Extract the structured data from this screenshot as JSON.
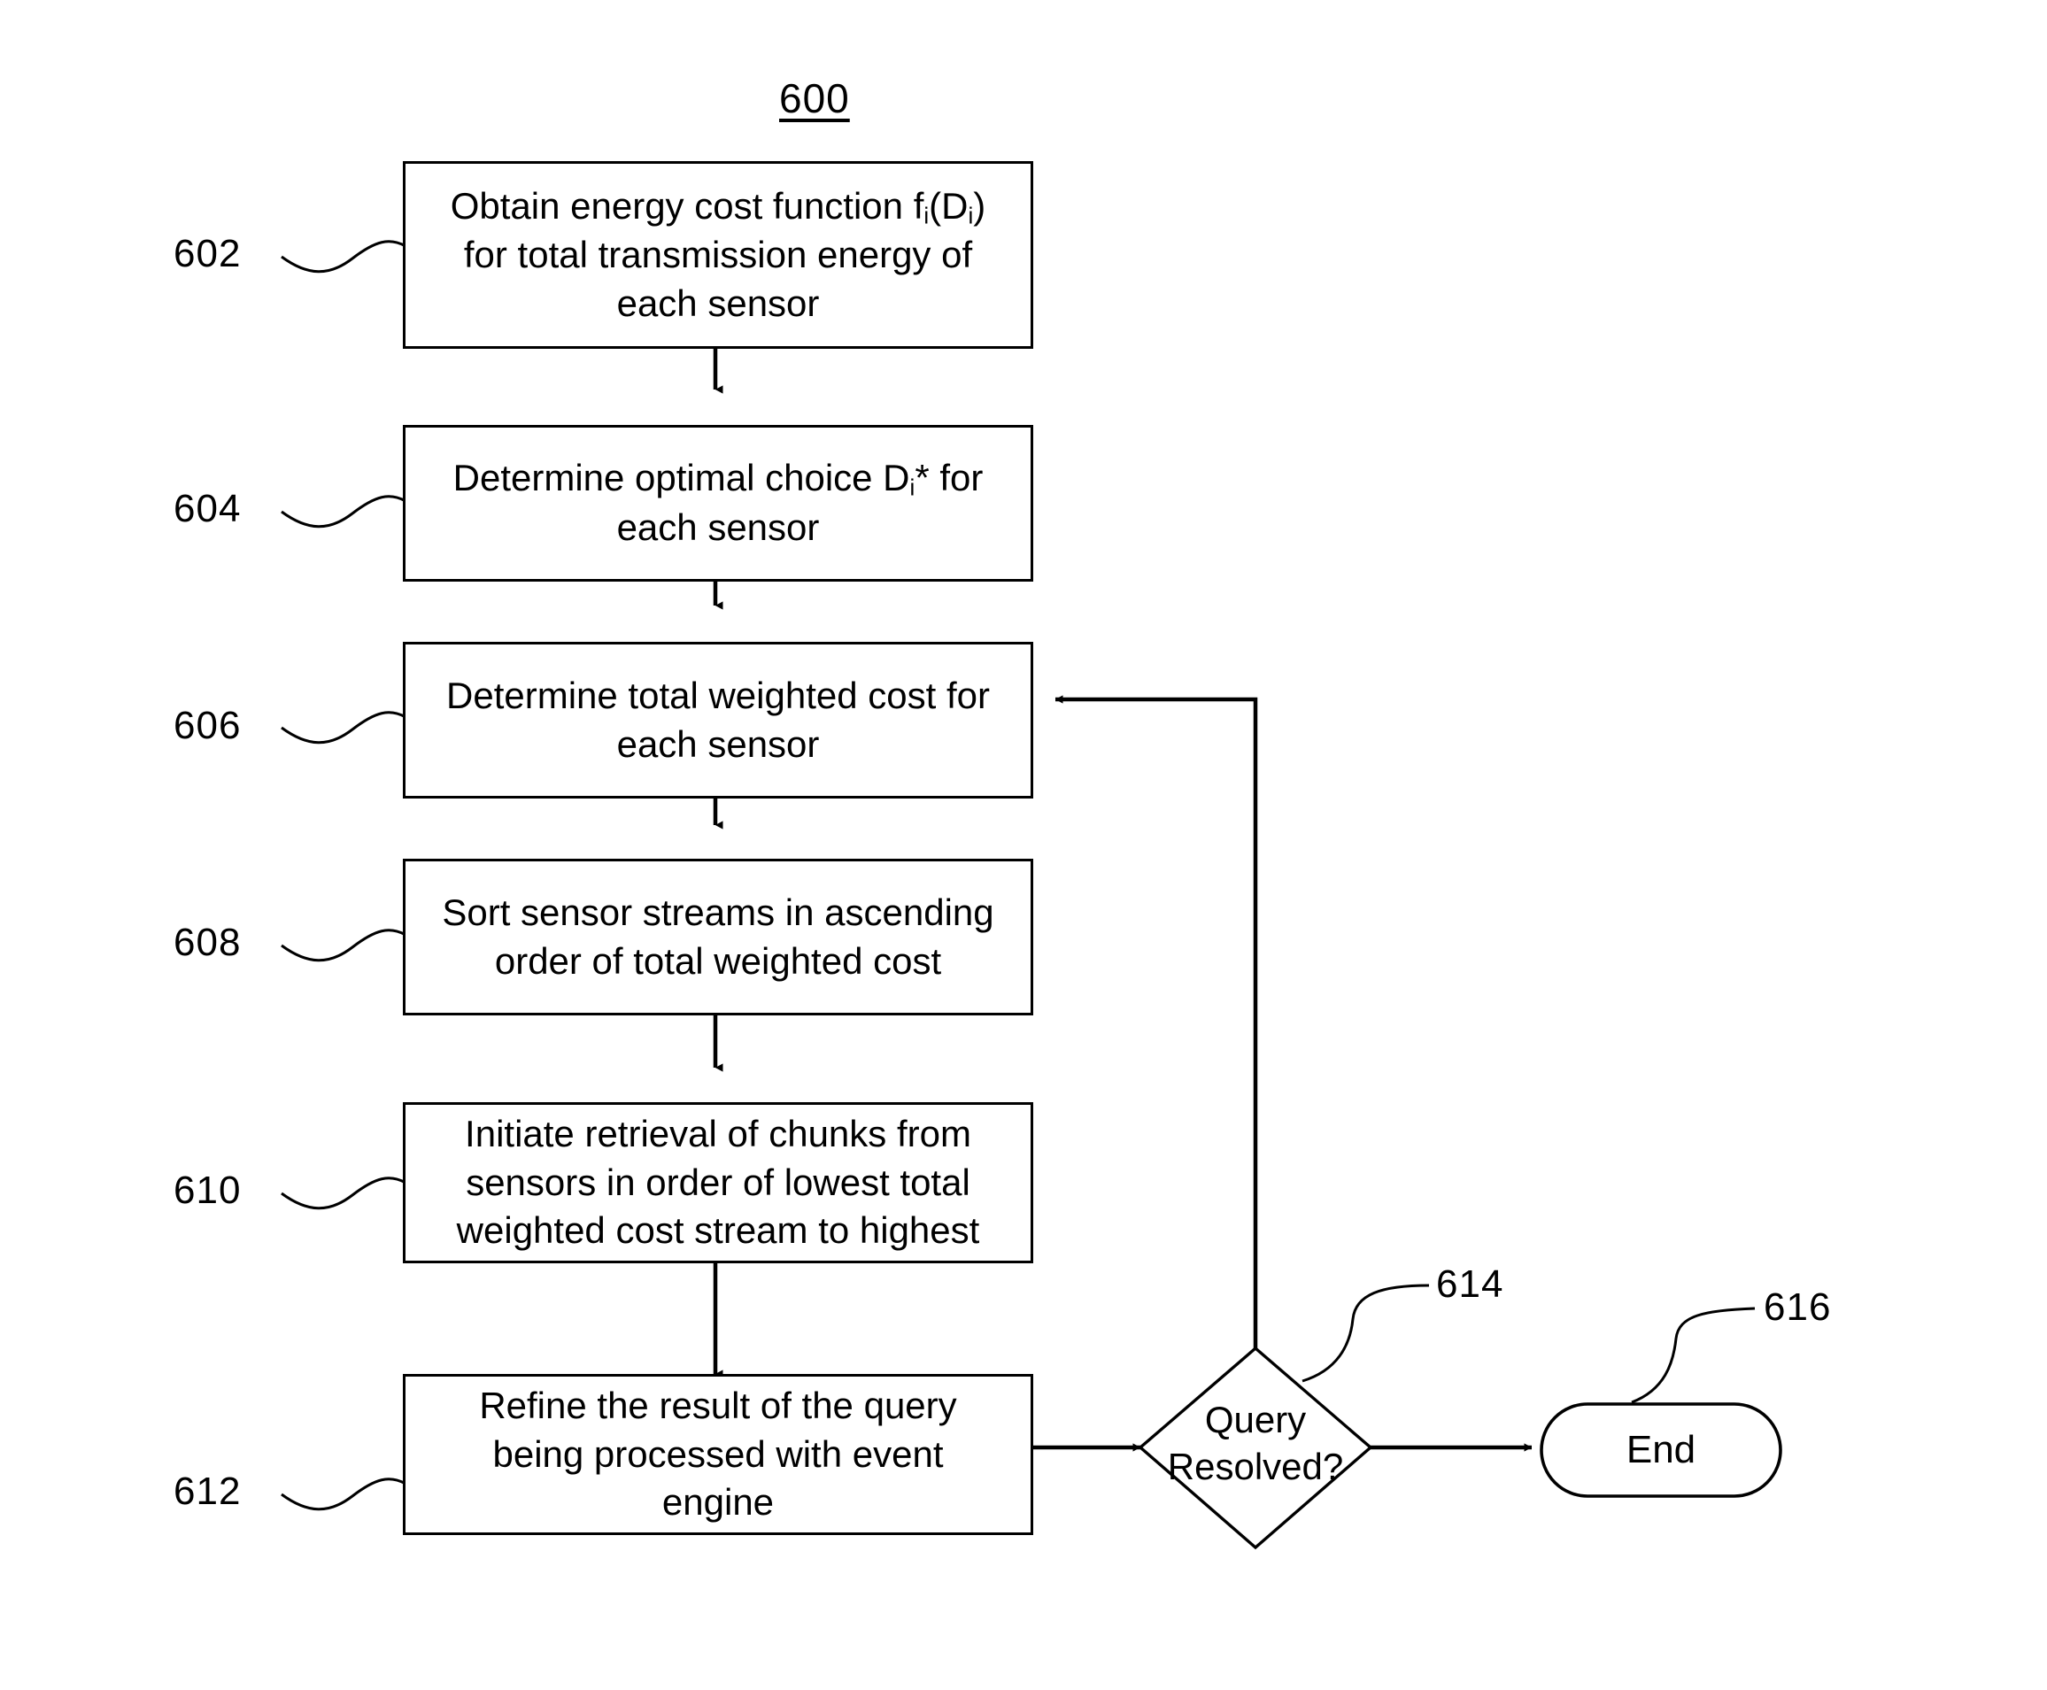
{
  "figure": {
    "number": "600",
    "title_position": "top-center"
  },
  "nodes": [
    {
      "ref": "602",
      "kind": "process",
      "lines": [
        "Obtain energy cost function f",
        "i",
        "(D",
        "i",
        ")"
      ],
      "text_line1_a": "Obtain energy cost function f",
      "text_line1_sub1": "i",
      "text_line1_b": "(D",
      "text_line1_sub2": "i",
      "text_line1_c": ")",
      "text_line2": "for total transmission energy of",
      "text_line3": "each sensor"
    },
    {
      "ref": "604",
      "kind": "process",
      "text_line1_a": "Determine optimal choice D",
      "text_line1_sub1": "i",
      "text_line1_b": "* for",
      "text_line2": "each sensor"
    },
    {
      "ref": "606",
      "kind": "process",
      "text_line1": "Determine total weighted cost for",
      "text_line2": "each sensor"
    },
    {
      "ref": "608",
      "kind": "process",
      "text_line1": "Sort sensor streams in ascending",
      "text_line2": "order of total weighted cost"
    },
    {
      "ref": "610",
      "kind": "process",
      "text_line1": "Initiate retrieval of chunks from",
      "text_line2": "sensors in order of lowest total",
      "text_line3": "weighted cost stream to highest"
    },
    {
      "ref": "612",
      "kind": "process",
      "text_line1": "Refine the result of the query",
      "text_line2": "being processed with event",
      "text_line3": "engine"
    },
    {
      "ref": "614",
      "kind": "decision",
      "text_line1": "Query",
      "text_line2": "Resolved?"
    },
    {
      "ref": "616",
      "kind": "terminator",
      "text_line1": "End"
    }
  ],
  "colors": {
    "stroke": "#000000",
    "background": "#ffffff"
  }
}
